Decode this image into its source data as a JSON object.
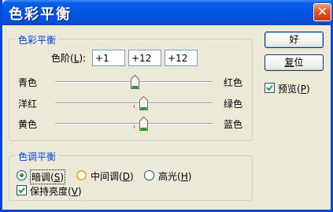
{
  "window": {
    "title": "色彩平衡",
    "close_glyph": "✕"
  },
  "color_balance": {
    "legend": "色彩平衡",
    "levels_label": "色阶(L):",
    "levels": [
      "+1",
      "+12",
      "+12"
    ],
    "sliders": [
      {
        "left": "青色",
        "right": "红色",
        "value": 1
      },
      {
        "left": "洋红",
        "right": "绿色",
        "value": 12
      },
      {
        "left": "黄色",
        "right": "蓝色",
        "value": 12
      }
    ],
    "range": [
      -100,
      100
    ]
  },
  "tone_balance": {
    "legend": "色调平衡",
    "options": [
      {
        "label": "暗调(S)",
        "selected": true
      },
      {
        "label": "中间调(D)",
        "selected": false
      },
      {
        "label": "高光(H)",
        "selected": false
      }
    ],
    "preserve_luminosity": {
      "label": "保持亮度(V)",
      "checked": true
    }
  },
  "buttons": {
    "ok": "好",
    "reset": "复位"
  },
  "preview": {
    "label": "预览(P)",
    "checked": true
  },
  "colors": {
    "title_bar": "#0055e5",
    "legend": "#0046d5",
    "thumb_green": "#21a121"
  }
}
